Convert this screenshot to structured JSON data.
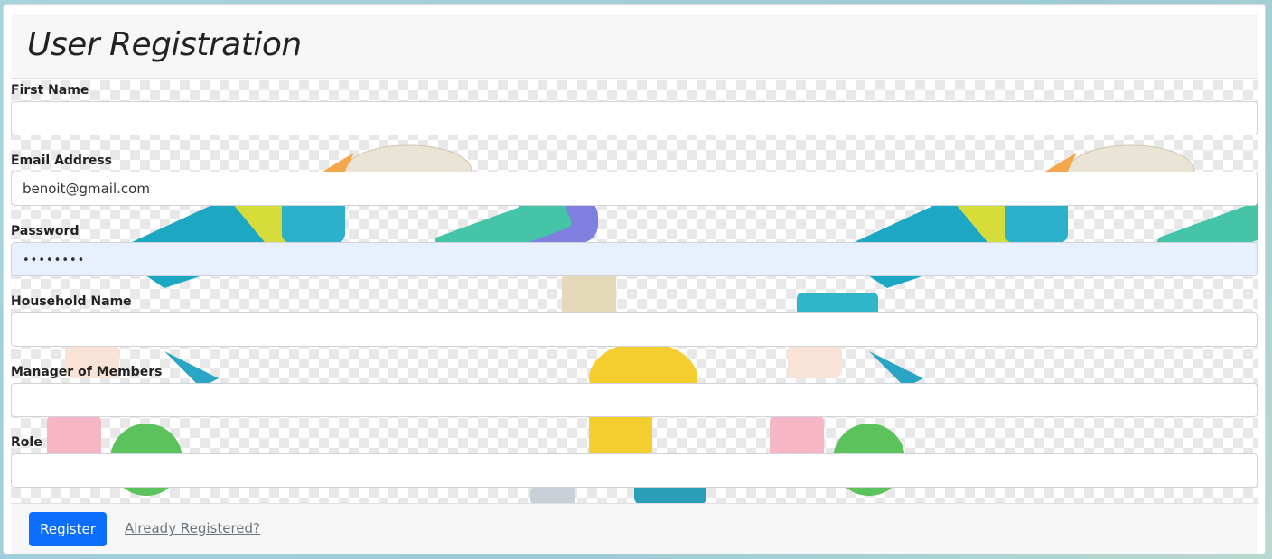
{
  "header": {
    "title": "User Registration"
  },
  "form": {
    "fields": [
      {
        "label": "First Name",
        "value": ""
      },
      {
        "label": "Email Address",
        "value": "benoit@gmail.com"
      },
      {
        "label": "Password",
        "value": "••••••••"
      },
      {
        "label": "Household Name",
        "value": ""
      },
      {
        "label": "Manager of Members",
        "value": ""
      },
      {
        "label": "Role",
        "value": ""
      }
    ]
  },
  "footer": {
    "register_label": "Register",
    "already_registered_label": "Already Registered?"
  },
  "colors": {
    "primary": "#0d6efd",
    "autofill_bg": "#e8f0fe",
    "muted_link": "#6c757d"
  }
}
